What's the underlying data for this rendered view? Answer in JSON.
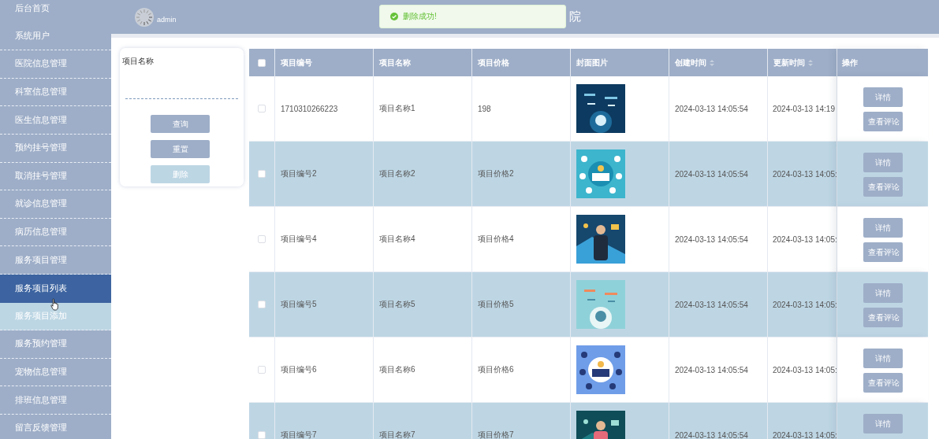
{
  "sidebar": {
    "items": [
      {
        "label": "后台首页",
        "selected": false
      },
      {
        "label": "系统用户",
        "selected": false
      },
      {
        "label": "医院信息管理",
        "selected": false
      },
      {
        "label": "科室信息管理",
        "selected": false
      },
      {
        "label": "医生信息管理",
        "selected": false
      },
      {
        "label": "预约挂号管理",
        "selected": false
      },
      {
        "label": "取消挂号管理",
        "selected": false
      },
      {
        "label": "就诊信息管理",
        "selected": false
      },
      {
        "label": "病历信息管理",
        "selected": false
      },
      {
        "label": "服务项目管理",
        "selected": false,
        "children": [
          {
            "label": "服务项目列表",
            "selected": true,
            "hovered": false
          },
          {
            "label": "服务项目添加",
            "selected": false,
            "hovered": true
          }
        ]
      },
      {
        "label": "服务预约管理",
        "selected": false
      },
      {
        "label": "宠物信息管理",
        "selected": false
      },
      {
        "label": "排班信息管理",
        "selected": false
      },
      {
        "label": "留言反馈管理",
        "selected": false
      }
    ]
  },
  "header": {
    "user": "admin",
    "title": "院"
  },
  "toast": {
    "kind": "success",
    "message": "删除成功!"
  },
  "search": {
    "fields": [
      {
        "label": "项目名称"
      }
    ],
    "buttons": [
      {
        "label": "查询",
        "disabled": false
      },
      {
        "label": "重置",
        "disabled": false
      },
      {
        "label": "删除",
        "disabled": true
      }
    ]
  },
  "table": {
    "select_all": {
      "checked": false
    },
    "columns": [
      {
        "label": "项目编号",
        "sortable": false
      },
      {
        "label": "项目名称",
        "sortable": false
      },
      {
        "label": "项目价格",
        "sortable": false
      },
      {
        "label": "封面图片",
        "sortable": false
      },
      {
        "label": "创建时间",
        "sortable": true
      },
      {
        "label": "更新时间",
        "sortable": true
      },
      {
        "label": "操作",
        "sortable": false
      }
    ],
    "rows": [
      {
        "checked": false,
        "cells": [
          "1710310266223",
          "项目名称1",
          "198",
          {
            "kind": "picture"
          },
          "2024-03-13 14:05:54",
          "2024-03-13 14:19"
        ],
        "actions": [
          "详情",
          "查看评论"
        ]
      },
      {
        "checked": false,
        "cells": [
          "项目编号2",
          "项目名称2",
          "项目价格2",
          {
            "kind": "picture"
          },
          "2024-03-13 14:05:54",
          "2024-03-13 14:05:"
        ],
        "actions": [
          "详情",
          "查看评论"
        ]
      },
      {
        "checked": false,
        "cells": [
          "项目编号4",
          "项目名称4",
          "项目价格4",
          {
            "kind": "picture"
          },
          "2024-03-13 14:05:54",
          "2024-03-13 14:05:"
        ],
        "actions": [
          "详情",
          "查看评论"
        ]
      },
      {
        "checked": false,
        "cells": [
          "项目编号5",
          "项目名称5",
          "项目价格5",
          {
            "kind": "picture"
          },
          "2024-03-13 14:05:54",
          "2024-03-13 14:05:"
        ],
        "actions": [
          "详情",
          "查看评论"
        ]
      },
      {
        "checked": false,
        "cells": [
          "项目编号6",
          "项目名称6",
          "项目价格6",
          {
            "kind": "picture"
          },
          "2024-03-13 14:05:54",
          "2024-03-13 14:05:"
        ],
        "actions": [
          "详情",
          "查看评论"
        ]
      },
      {
        "checked": false,
        "cells": [
          "项目编号7",
          "项目名称7",
          "项目价格7",
          {
            "kind": "picture"
          },
          "2024-03-13 14:05:54",
          "2024-03-13 14:05:"
        ],
        "actions": [
          "详情"
        ]
      }
    ]
  }
}
